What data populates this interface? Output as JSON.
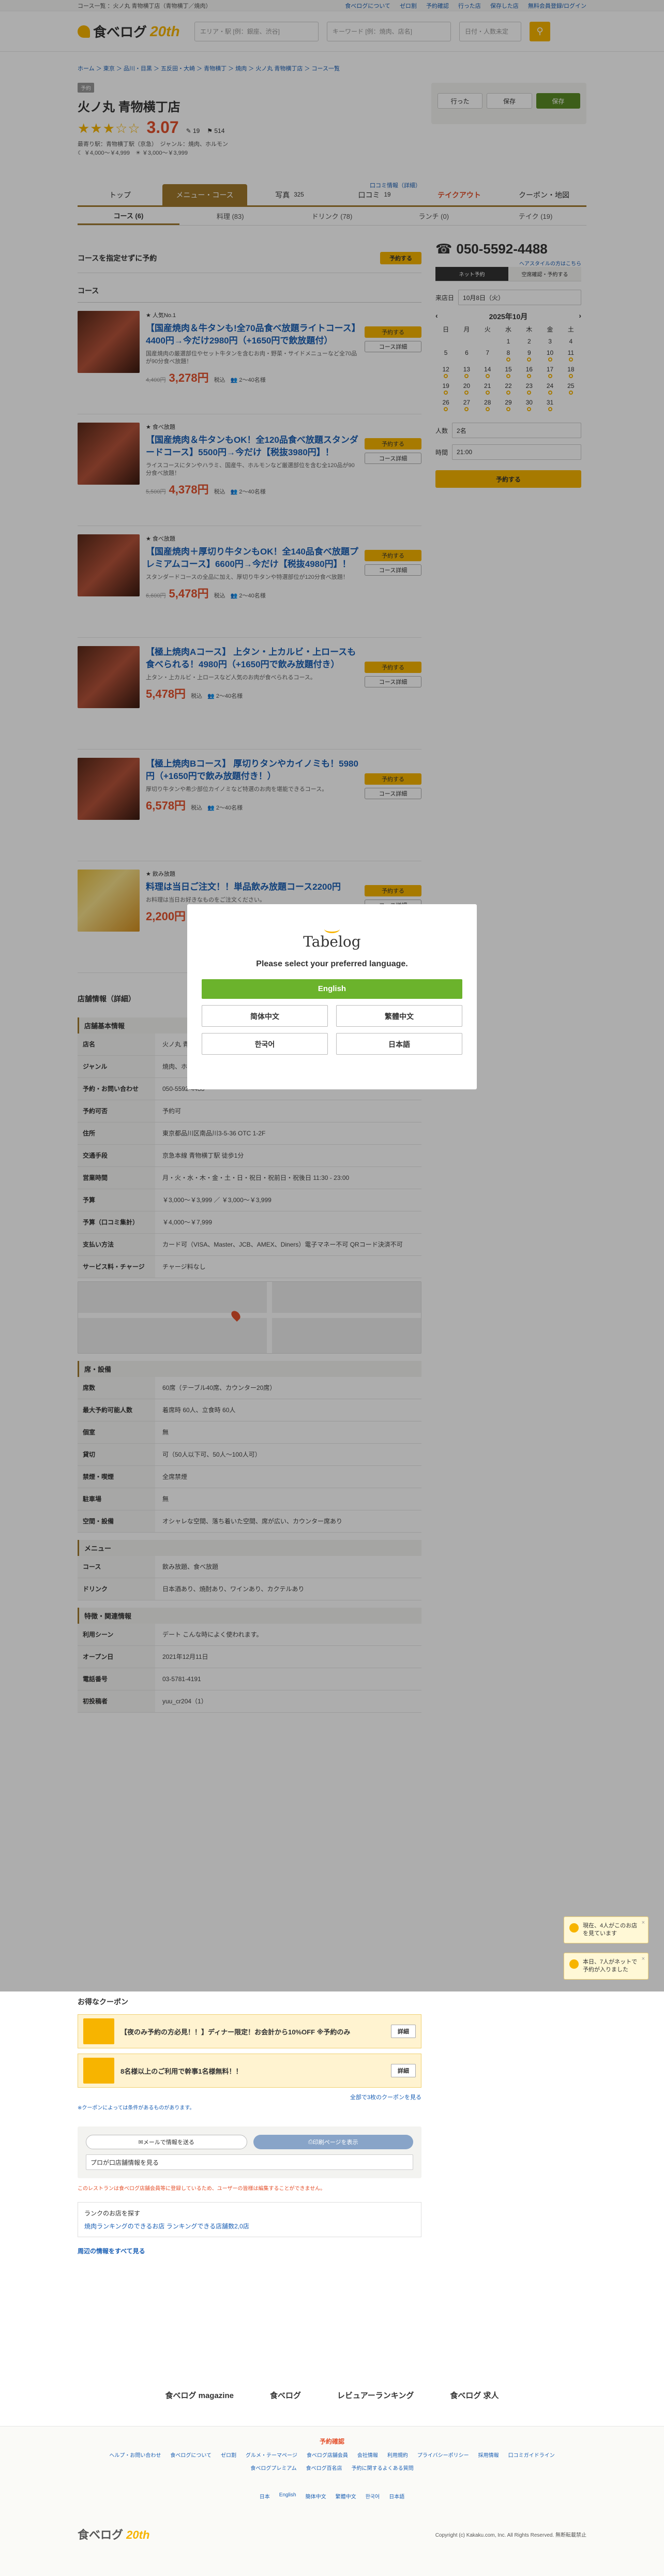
{
  "topbar": {
    "left": "コース一覧 ：火ノ丸 青物横丁店（青物横丁／焼肉）",
    "links": [
      "食べログについて",
      "ゼロ割",
      "予約確認",
      "行った店",
      "保存した店",
      "無料会員登録/ログイン"
    ]
  },
  "header": {
    "logo_text": "食べログ",
    "logo_year": "20th",
    "area_placeholder": "エリア・駅 [例：銀座、渋谷]",
    "keyword_placeholder": "キーワード [例：焼肉、店名]",
    "date_placeholder": "日付・人数未定"
  },
  "breadcrumb": "ホーム ＞ 東京 ＞ 品川・目黒 ＞ 五反田・大崎 ＞ 青物横丁 ＞ 焼肉 ＞ 火ノ丸 青物横丁店 ＞ コース一覧",
  "restaurant": {
    "badge": "予約",
    "name": "火ノ丸 青物横丁店",
    "stars": "★★★☆☆",
    "score": "3.07",
    "reviews": "19",
    "saves": "514",
    "station": "最寄り駅：青物横丁駅（京急）",
    "genre": "ジャンル：焼肉、ホルモン",
    "price_dinner": "￥4,000～￥4,999",
    "price_lunch": "￥3,000～￥3,999",
    "coupon_link": "口コミ情報（詳細）",
    "visited": "行った",
    "saved": "保存",
    "save_btn": "保存"
  },
  "tabs": [
    {
      "label": "トップ"
    },
    {
      "label": "メニュー・コース"
    },
    {
      "label": "写真",
      "count": "325"
    },
    {
      "label": "口コミ",
      "count": "19"
    },
    {
      "label": "テイクアウト"
    },
    {
      "label": "クーポン・地図"
    }
  ],
  "subtabs": [
    "コース (6)",
    "料理 (83)",
    "ドリンク (78)",
    "ランチ (0)",
    "テイク (19)"
  ],
  "main": {
    "reserve_by_course": "コースを指定せずに予約",
    "reserve_btn": "予約する",
    "courses_heading": "コース",
    "info_heading": "店舗情報（詳細）"
  },
  "courses": [
    {
      "badge": "人気No.1",
      "title": "【国産焼肉＆牛タンも!全70品食べ放題ライトコース】4400円→今だけ2980円（+1650円で飲放題付）",
      "desc": "国産焼肉の厳選部位やセット牛タンを含むお肉・野菜・サイドメニューなど全70品が90分食べ放題！",
      "old": "4,400円",
      "price": "3,278円",
      "tax": "税込",
      "people": "2～40名様",
      "btn1": "予約する",
      "btn2": "コース詳細"
    },
    {
      "badge": "食べ放題",
      "title": "【国産焼肉＆牛タンもOK！全120品食べ放題スタンダードコース】5500円→今だけ【税抜3980円】！",
      "desc": "ライスコースにタンやハラミ、国産牛、ホルモンなど厳選部位を含む全120品が90分食べ放題！",
      "old": "5,500円",
      "price": "4,378円",
      "tax": "税込",
      "people": "2～40名様",
      "btn1": "予約する",
      "btn2": "コース詳細"
    },
    {
      "badge": "食べ放題",
      "title": "【国産焼肉＋厚切り牛タンもOK！全140品食べ放題プレミアムコース】6600円→今だけ【税抜4980円】！",
      "desc": "スタンダードコースの全品に加え、厚切り牛タンや特選部位が120分食べ放題！",
      "old": "6,600円",
      "price": "5,478円",
      "tax": "税込",
      "people": "2～40名様",
      "btn1": "予約する",
      "btn2": "コース詳細"
    },
    {
      "badge": "",
      "title": "【極上焼肉Aコース】 上タン・上カルビ・上ロースも食べられる！4980円（+1650円で飲み放題付き）",
      "desc": "上タン・上カルビ・上ロースなど人気のお肉が食べられるコース。",
      "old": "",
      "price": "5,478円",
      "tax": "税込",
      "people": "2～40名様",
      "btn1": "予約する",
      "btn2": "コース詳細"
    },
    {
      "badge": "",
      "title": "【極上焼肉Bコース】 厚切りタンやカイノミも！5980円（+1650円で飲み放題付き！）",
      "desc": "厚切り牛タンや希少部位カイノミなど特選のお肉を堪能できるコース。",
      "old": "",
      "price": "6,578円",
      "tax": "税込",
      "people": "2～40名様",
      "btn1": "予約する",
      "btn2": "コース詳細"
    },
    {
      "badge": "飲み放題",
      "title": "料理は当日ご注文！！単品飲み放題コース2200円",
      "desc": "お料理は当日お好きなものをご注文ください。",
      "old": "",
      "price": "2,200円",
      "tax": "税込",
      "people": "2～40名様",
      "btn1": "予約する",
      "btn2": "コース詳細"
    }
  ],
  "info": {
    "sub_basic": "店舗基本情報",
    "rows": [
      {
        "k": "店名",
        "v": "火ノ丸 青物横丁店"
      },
      {
        "k": "ジャンル",
        "v": "焼肉、ホルモン"
      },
      {
        "k": "予約・お問い合わせ",
        "v": "050-5592-4488"
      },
      {
        "k": "予約可否",
        "v": "予約可"
      },
      {
        "k": "住所",
        "v": "東京都品川区南品川3-5-36 OTC 1-2F"
      },
      {
        "k": "交通手段",
        "v": "京急本線 青物横丁駅 徒歩1分"
      },
      {
        "k": "営業時間",
        "v": "月・火・水・木・金・土・日・祝日・祝前日・祝後日 11:30 - 23:00"
      },
      {
        "k": "予算",
        "v": "￥3,000～￥3,999 ／ ￥3,000～￥3,999"
      },
      {
        "k": "予算（口コミ集計）",
        "v": "￥4,000～￥7,999"
      },
      {
        "k": "支払い方法",
        "v": "カード可（VISA、Master、JCB、AMEX、Diners）電子マネー不可 QRコード決済不可"
      },
      {
        "k": "サービス料・チャージ",
        "v": "チャージ料なし"
      }
    ],
    "sub_seat": "席・設備",
    "seat_rows": [
      {
        "k": "席数",
        "v": "60席（テーブル40席、カウンター20席）"
      },
      {
        "k": "最大予約可能人数",
        "v": "着席時 60人、立食時 60人"
      },
      {
        "k": "個室",
        "v": "無"
      },
      {
        "k": "貸切",
        "v": "可（50人以下可、50人～100人可）"
      },
      {
        "k": "禁煙・喫煙",
        "v": "全席禁煙"
      },
      {
        "k": "駐車場",
        "v": "無"
      },
      {
        "k": "空間・設備",
        "v": "オシャレな空間、落ち着いた空間、席が広い、カウンター席あり"
      }
    ],
    "sub_menu": "メニュー",
    "menu_rows": [
      {
        "k": "コース",
        "v": "飲み放題、食べ放題"
      },
      {
        "k": "ドリンク",
        "v": "日本酒あり、焼酎あり、ワインあり、カクテルあり"
      }
    ],
    "sub_feature": "特徴・関連情報",
    "feature_rows": [
      {
        "k": "利用シーン",
        "v": "デート こんな時によく使われます。"
      },
      {
        "k": "オープン日",
        "v": "2021年12月11日"
      },
      {
        "k": "電話番号",
        "v": "03-5781-4191"
      },
      {
        "k": "初投稿者",
        "v": "yuu_cr204（1）"
      }
    ]
  },
  "side": {
    "tel": "050-5592-4488",
    "tel_note": "ヘアスタイルの方はこちら",
    "tab1": "ネット予約",
    "tab2": "空席確認・予約する",
    "date_label": "来店日",
    "date_value": "10月8日（火）",
    "month": "2025年10月",
    "week": [
      "日",
      "月",
      "火",
      "水",
      "木",
      "金",
      "土"
    ],
    "days": [
      "",
      "",
      "",
      "1",
      "2",
      "3",
      "4",
      "5",
      "6",
      "7",
      "8",
      "9",
      "10",
      "11",
      "12",
      "13",
      "14",
      "15",
      "16",
      "17",
      "18",
      "19",
      "20",
      "21",
      "22",
      "23",
      "24",
      "25",
      "26",
      "27",
      "28",
      "29",
      "30",
      "31",
      ""
    ],
    "people_label": "人数",
    "people_value": "2名",
    "time_label": "時間",
    "time_value": "21:00",
    "btn": "予約する"
  },
  "modal": {
    "logo": "Tabelog",
    "title": "Please select your preferred language.",
    "english": "English",
    "langs": [
      "简体中文",
      "繁體中文",
      "한국어",
      "日本語"
    ]
  },
  "toasts": [
    {
      "text": "現在、4人がこのお店を見ています"
    },
    {
      "text": "本日、7人がネットで予約が入りました"
    }
  ],
  "lower": {
    "coupon_heading": "お得なクーポン",
    "coupons": [
      {
        "text": "【夜のみ予約の方必見！！】ディナー限定！お会計から10%OFF ※予約のみ",
        "btn": "詳細"
      },
      {
        "text": "8名様以上のご利用で幹事1名様無料！！",
        "btn": "詳細"
      }
    ],
    "coupon_all": "全部で3枚のクーポンを見る",
    "note": "※クーポンによっては条件があるものがあります。",
    "mail_btn": "メールで情報を送る",
    "share_btn": "印刷ページを表示",
    "prop_link": "プロが口店舗情報を見る",
    "owner_note": "このレストランは食べログ店舗会員等に登録しているため、ユーザーの皆様は編集することができません。",
    "rank_heading": "ランクのお店を探す",
    "rank_link": "焼肉ランキングのできるお店 ランキングできる店舗数2,0店",
    "related_link": "周辺の情報をすべて見る"
  },
  "brands": [
    "食べログ magazine",
    "食べログ",
    "レビュアーランキング",
    "食べログ 求人"
  ],
  "footer": {
    "reserve_link": "予約確認",
    "links": [
      "ヘルプ・お問い合わせ",
      "食べログについて",
      "ゼロ割",
      "グルメ・テーマページ",
      "食べログ店舗会員",
      "会社情報",
      "利用規約",
      "プライバシーポリシー",
      "採用情報",
      "口コミガイドライン",
      "食べログプレミアム",
      "食べログ百名店",
      "予約に関するよくある質問"
    ],
    "langs": [
      "日本",
      "English",
      "簡体中文",
      "繁體中文",
      "한국어",
      "日本語"
    ],
    "copyright": "Copyright (c) Kakaku.com, Inc. All Rights Reserved. 無断転載禁止",
    "logo": "食べログ",
    "year": "20th"
  }
}
